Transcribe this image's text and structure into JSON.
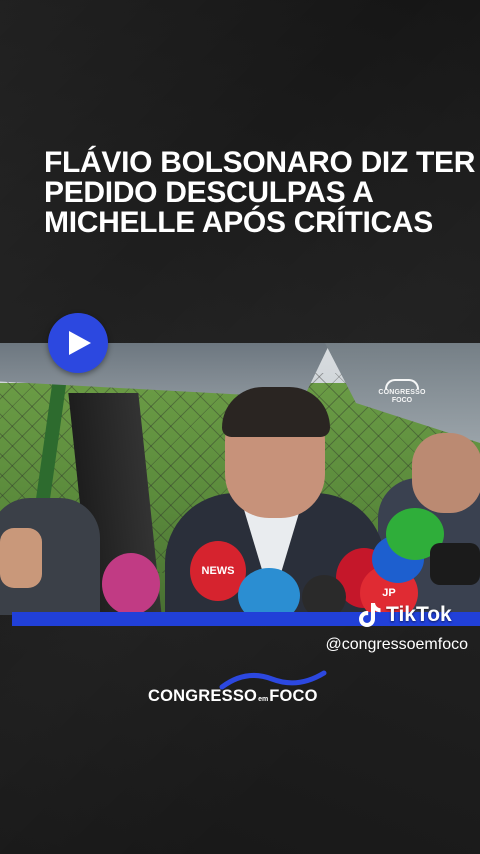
{
  "headline": {
    "lines": [
      "FLÁVIO BOLSONARO DIZ TER",
      "PEDIDO DESCULPAS A",
      "MICHELLE APÓS CRÍTICAS"
    ]
  },
  "player": {
    "play_icon": "play-icon"
  },
  "video": {
    "watermark_line1": "CONGRESSO",
    "watermark_line2": "FOCO",
    "mic_labels": {
      "news": "NEWS",
      "jp": "JP"
    }
  },
  "tiktok": {
    "label": "TikTok",
    "icon": "tiktok-icon"
  },
  "handle": "@congressoemfoco",
  "logo": {
    "part1": "CONGRESSO",
    "part2": "em",
    "part3": "FOCO"
  },
  "colors": {
    "accent_blue": "#2c48e0",
    "bar_blue": "#2140d8",
    "background": "#1d1d1d"
  }
}
